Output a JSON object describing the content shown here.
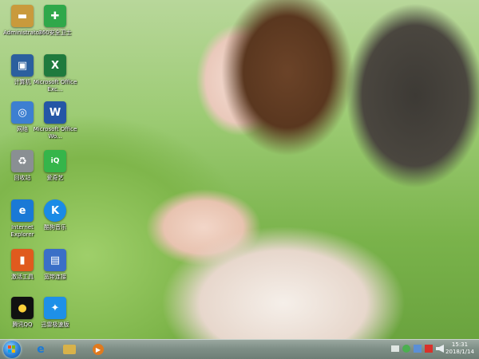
{
  "desktop": {
    "icons_left": [
      {
        "label": "Administrator",
        "icon": "folder-icon",
        "color": "#c99a3c"
      },
      {
        "label": "计算机",
        "icon": "computer-icon",
        "color": "#2b5f9e"
      },
      {
        "label": "网络",
        "icon": "network-icon",
        "color": "#3d7fd1"
      },
      {
        "label": "回收站",
        "icon": "recycle-bin-icon",
        "color": "#8a8f93"
      },
      {
        "label": "Internet Explorer",
        "icon": "internet-explorer-icon",
        "color": "#1a79d6"
      },
      {
        "label": "激活工具",
        "icon": "activation-tool-icon",
        "color": "#e05a1e"
      },
      {
        "label": "腾讯QQ",
        "icon": "qq-icon",
        "color": "#111111"
      }
    ],
    "icons_right": [
      {
        "label": "360安全卫士",
        "icon": "360-safe-icon",
        "color": "#2fa84a"
      },
      {
        "label": "Microsoft Office Exc...",
        "icon": "excel-icon",
        "color": "#1f7a3d"
      },
      {
        "label": "Microsoft Office Wo...",
        "icon": "word-icon",
        "color": "#2456a6"
      },
      {
        "label": "爱奇艺",
        "icon": "iqiyi-icon",
        "color": "#35b54a"
      },
      {
        "label": "酷狗音乐",
        "icon": "kugou-icon",
        "color": "#1a8be6"
      },
      {
        "label": "宽带连接",
        "icon": "broadband-icon",
        "color": "#3a6fc7"
      },
      {
        "label": "迅雷极速版",
        "icon": "xunlei-icon",
        "color": "#1e90e8"
      }
    ]
  },
  "taskbar": {
    "start_icon": "windows-start-icon",
    "pinned": [
      {
        "name": "ie",
        "icon": "internet-explorer-icon",
        "color": "#1a79d6"
      },
      {
        "name": "explorer",
        "icon": "folder-icon",
        "color": "#d8b24a"
      },
      {
        "name": "media-player",
        "icon": "media-player-icon",
        "color": "#e07a1e"
      }
    ],
    "clock": {
      "time": "15:31",
      "date": "2018/1/14"
    }
  }
}
